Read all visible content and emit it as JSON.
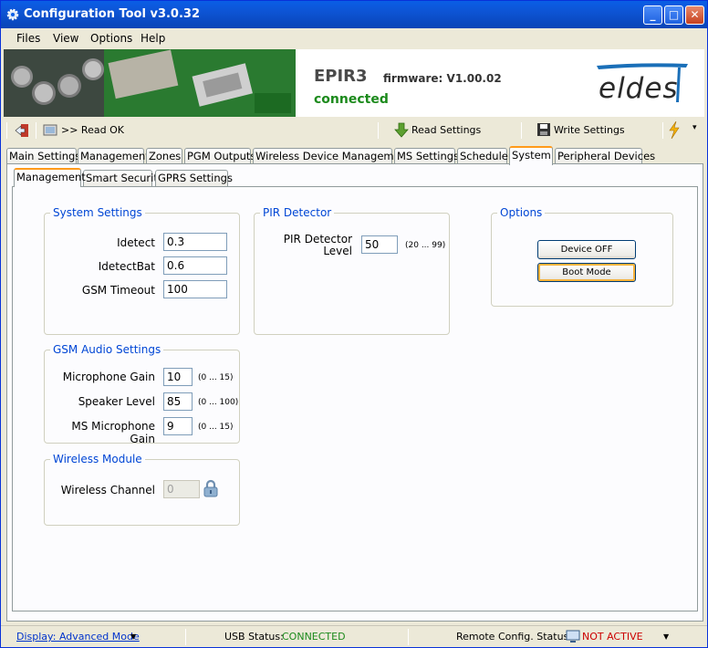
{
  "window": {
    "title": "Configuration Tool v3.0.32"
  },
  "menu": [
    "Files",
    "View",
    "Options",
    "Help"
  ],
  "banner": {
    "device": "EPIR3",
    "firmware": "firmware: V1.00.02",
    "status": "connected",
    "logo": "eldes"
  },
  "toolbar": {
    "read_ok": ">> Read OK",
    "read_settings": "Read Settings",
    "write_settings": "Write Settings"
  },
  "tabs": [
    "Main Settings",
    "Management",
    "Zones",
    "PGM Outputs",
    "Wireless Device Management",
    "MS Settings",
    "Scheduler",
    "System",
    "Peripheral Devices"
  ],
  "active_tab": "System",
  "subtabs": [
    "Management",
    "Smart Security",
    "GPRS Settings"
  ],
  "active_subtab": "Management",
  "system_settings": {
    "title": "System Settings",
    "idetect_label": "Idetect",
    "idetect_value": "0.3",
    "idetectbat_label": "IdetectBat",
    "idetectbat_value": "0.6",
    "gsm_timeout_label": "GSM Timeout",
    "gsm_timeout_value": "100"
  },
  "pir_detector": {
    "title": "PIR Detector",
    "level_label_1": "PIR Detector",
    "level_label_2": "Level",
    "level_value": "50",
    "level_range": "(20 ... 99)"
  },
  "options": {
    "title": "Options",
    "device_off": "Device OFF",
    "boot_mode": "Boot Mode"
  },
  "gsm_audio": {
    "title": "GSM Audio Settings",
    "mic_gain_label": "Microphone Gain",
    "mic_gain_value": "10",
    "mic_gain_range": "(0 ... 15)",
    "speaker_label": "Speaker Level",
    "speaker_value": "85",
    "speaker_range": "(0 ... 100)",
    "ms_mic_label": "MS Microphone Gain",
    "ms_mic_value": "9",
    "ms_mic_range": "(0 ... 15)"
  },
  "wireless_module": {
    "title": "Wireless Module",
    "channel_label": "Wireless Channel",
    "channel_value": "0"
  },
  "statusbar": {
    "display_mode": "Display: Advanced Mode",
    "usb_label": "USB Status:",
    "usb_value": "CONNECTED",
    "remote_label": "Remote Config. Status:",
    "remote_value": "NOT ACTIVE"
  },
  "colors": {
    "title_bar": "#0a5ee6",
    "connected": "#1c8a1c",
    "legend": "#0046d5",
    "not_active": "#cc0000"
  }
}
